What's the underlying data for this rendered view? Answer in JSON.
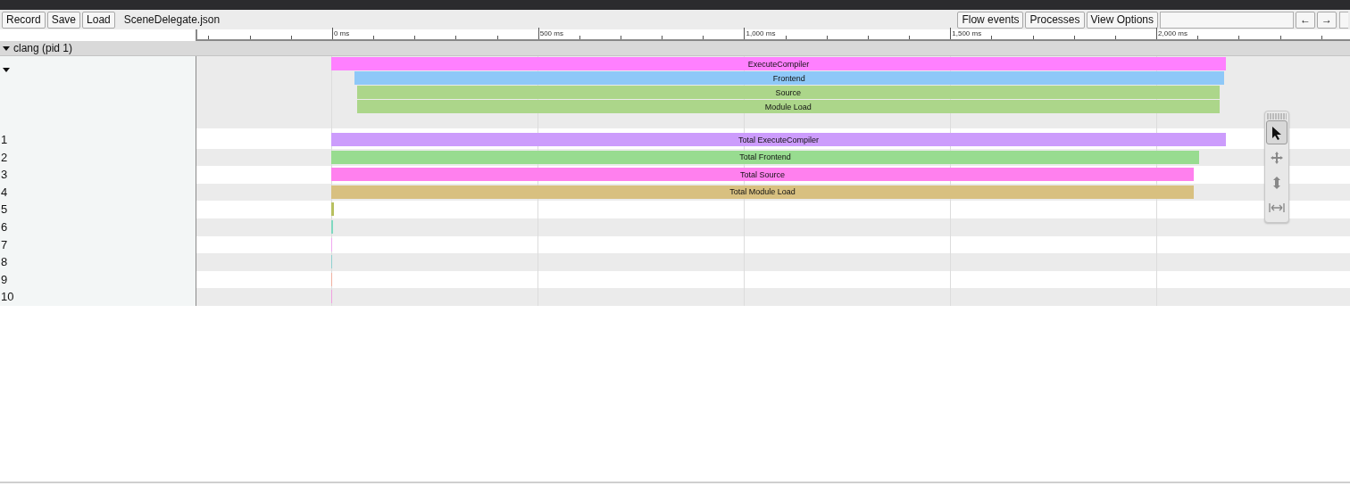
{
  "toolbar": {
    "left_buttons": [
      "Record",
      "Save",
      "Load"
    ],
    "filename": "SceneDelegate.json",
    "right_buttons": [
      "Flow events",
      "Processes",
      "View Options"
    ],
    "nav_buttons": [
      "←",
      "→"
    ]
  },
  "ruler": {
    "ticks": [
      "0 ms",
      "500 ms",
      "1,000 ms",
      "1,500 ms",
      "2,000 ms"
    ]
  },
  "process": {
    "label": "clang (pid 1)",
    "expanded": true
  },
  "thread": {
    "expanded": true,
    "slices": [
      {
        "name": "ExecuteCompiler",
        "color": "#ff80ff",
        "children": [
          {
            "name": "Frontend",
            "color": "#8ec8f8",
            "children": [
              {
                "name": "Source",
                "color": "#acd68a",
                "children": [
                  {
                    "name": "Module Load",
                    "color": "#acd68a"
                  }
                ]
              }
            ]
          }
        ]
      }
    ]
  },
  "counters": [
    {
      "label": "1",
      "name": "Total ExecuteCompiler",
      "color": "#cc9cfc"
    },
    {
      "label": "2",
      "name": "Total Frontend",
      "color": "#98dc90"
    },
    {
      "label": "3",
      "name": "Total Source",
      "color": "#ff80ee"
    },
    {
      "label": "4",
      "name": "Total Module Load",
      "color": "#d8c080"
    },
    {
      "label": "5",
      "color": "#b8c060"
    },
    {
      "label": "6",
      "color": "#80d8c0"
    },
    {
      "label": "7",
      "color": "#f0a8f0"
    },
    {
      "label": "8",
      "color": "#90d0d0"
    },
    {
      "label": "9",
      "color": "#f0b0a0"
    },
    {
      "label": "10",
      "color": "#f0a0e0"
    }
  ],
  "tools": [
    {
      "kind": "select",
      "selected": true
    },
    {
      "kind": "pan",
      "selected": false
    },
    {
      "kind": "zoom",
      "selected": false
    },
    {
      "kind": "timing",
      "selected": false
    }
  ]
}
